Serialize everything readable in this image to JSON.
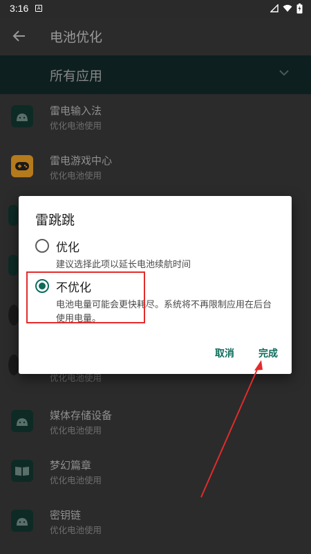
{
  "status_bar": {
    "time": "3:16",
    "notification_icon": "A"
  },
  "app_bar": {
    "title": "电池优化"
  },
  "filter": {
    "label": "所有应用"
  },
  "apps": [
    {
      "name": "雷电输入法",
      "status": "优化电池使用",
      "icon": "android-icon"
    },
    {
      "name": "雷电游戏中心",
      "status": "优化电池使用",
      "icon": "gamepad-icon"
    },
    {
      "name": "媒体存储设备",
      "status": "优化电池使用",
      "icon": "android-icon"
    },
    {
      "name": "梦幻篇章",
      "status": "优化电池使用",
      "icon": "book-icon"
    },
    {
      "name": "密钥链",
      "status": "优化电池使用",
      "icon": "android-icon"
    }
  ],
  "partial_row_text": "优化电池使用",
  "dialog": {
    "title": "雷跳跳",
    "options": [
      {
        "label": "优化",
        "desc": "建议选择此项以延长电池续航时间",
        "checked": false
      },
      {
        "label": "不优化",
        "desc": "电池电量可能会更快耗尽。系统将不再限制应用在后台使用电量。",
        "checked": true
      }
    ],
    "cancel": "取消",
    "done": "完成"
  },
  "colors": {
    "accent": "#0c6b5b",
    "annotation": "#e32b2b"
  }
}
